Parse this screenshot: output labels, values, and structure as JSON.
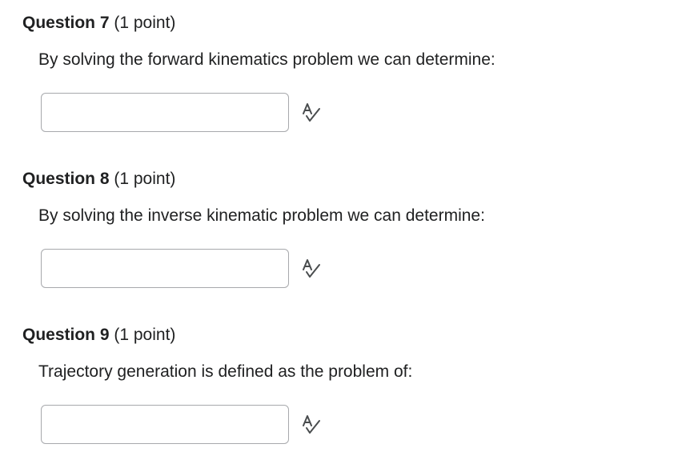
{
  "questions": [
    {
      "title": "Question 7",
      "points": "(1 point)",
      "prompt": "By solving the forward kinematics problem we can determine:",
      "answer_value": "",
      "spellcheck_icon": "spellcheck-icon"
    },
    {
      "title": "Question 8",
      "points": "(1 point)",
      "prompt": "By solving the inverse kinematic problem we can determine:",
      "answer_value": "",
      "spellcheck_icon": "spellcheck-icon"
    },
    {
      "title": "Question 9",
      "points": "(1 point)",
      "prompt": "Trajectory generation is defined as the problem of:",
      "answer_value": "",
      "spellcheck_icon": "spellcheck-icon"
    }
  ],
  "colors": {
    "text": "#202122",
    "input_border": "#a7a9ac",
    "icon": "#494c4e"
  }
}
